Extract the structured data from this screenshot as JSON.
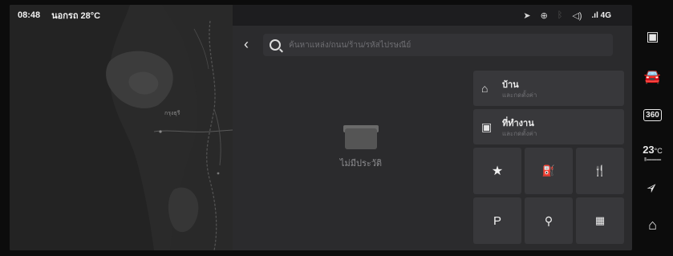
{
  "status": {
    "time": "08:48",
    "weather": "นอกรถ 28°C",
    "network": "4G"
  },
  "map": {
    "labels": [
      "กรุงธุรี"
    ]
  },
  "search": {
    "placeholder": "ค้นหาแหล่ง/ถนน/ร้าน/รหัสไปรษณีย์"
  },
  "empty": {
    "text": "ไม่มีประวัติ"
  },
  "shortcuts": {
    "home": {
      "title": "บ้าน",
      "subtitle": "และกดตั้งค่า"
    },
    "work": {
      "title": "ที่ทำงาน",
      "subtitle": "และกดตั้งค่า"
    }
  },
  "grid": {
    "parking_label": "P"
  },
  "dock": {
    "temperature": "23",
    "temperature_unit": "°C"
  }
}
